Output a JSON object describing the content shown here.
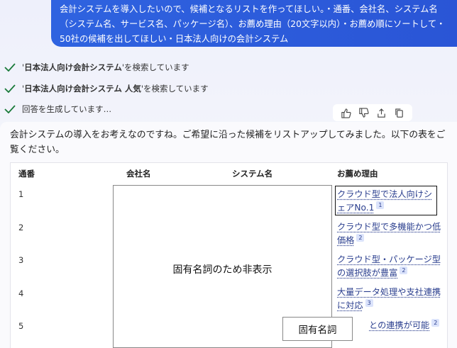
{
  "user_message": "会計システムを導入したいので、候補となるリストを作ってほしい。・通番、会社名、システム名（システム名、サービス名、パッケージ名）、お薦め理由（20文字以内）・お薦め順にソートして・50社の候補を出してほしい・日本法人向けの会計システム",
  "steps": [
    {
      "query": "日本法人向け会計システム",
      "suffix": "を検索しています"
    },
    {
      "query": "日本法人向け会計システム 人気",
      "suffix": "を検索しています"
    },
    {
      "text": "回答を生成しています…"
    }
  ],
  "actions": {
    "icons": [
      "thumbs-up-icon",
      "thumbs-down-icon",
      "share-icon",
      "copy-icon"
    ]
  },
  "answer": {
    "intro": "会計システムの導入をお考えなのですね。ご希望に沿った候補をリストアップしてみました。以下の表をご覧ください。"
  },
  "table": {
    "headers": [
      "通番",
      "会社名",
      "システム名",
      "お薦め理由"
    ],
    "rows": [
      {
        "num": "1",
        "reason": "クラウド型で法人向けシェアNo.1",
        "cite": "1"
      },
      {
        "num": "2",
        "reason": "クラウド型で多機能かつ低価格",
        "cite": "2"
      },
      {
        "num": "3",
        "reason": "クラウド型・パッケージ型の選択肢が豊富",
        "cite": "2"
      },
      {
        "num": "4",
        "reason": "大量データ処理や支社連携に対応",
        "cite": "3"
      },
      {
        "num": "5",
        "reason": "との連携が可能",
        "cite": "2"
      }
    ]
  },
  "redaction": {
    "main_label": "固有名詞のため非表示",
    "small_label": "固有名詞"
  },
  "colors": {
    "accent": "#2f63e0",
    "check": "#1a7a3a",
    "link": "#2a3e8e"
  }
}
